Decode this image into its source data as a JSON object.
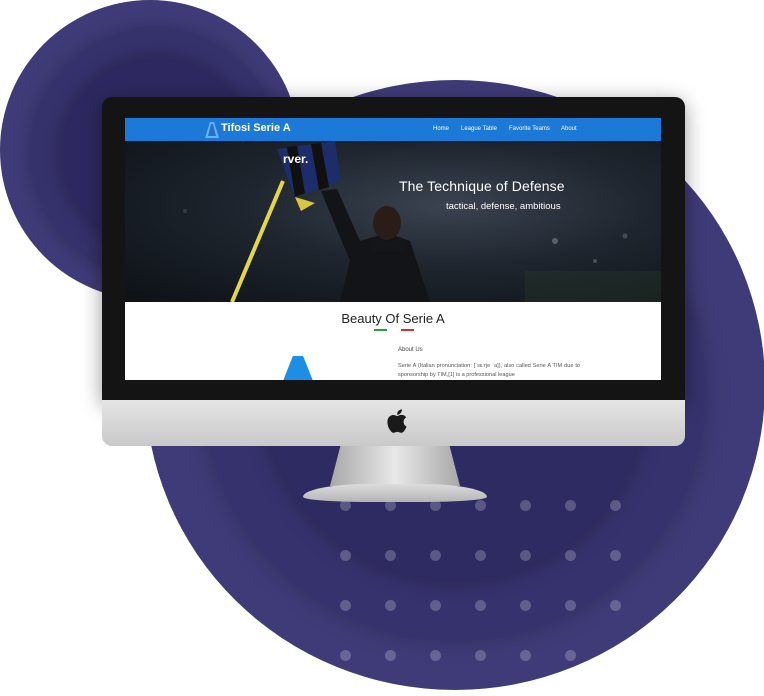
{
  "site": {
    "brand": "Tifosi Serie A",
    "nav": [
      {
        "label": "Home"
      },
      {
        "label": "League Table"
      },
      {
        "label": "Favorite Teams"
      },
      {
        "label": "About"
      }
    ]
  },
  "hero": {
    "title": "The Technique of Defense",
    "subtitle": "tactical, defense, ambitious",
    "shirt_text": "rver."
  },
  "section": {
    "title": "Beauty Of Serie A",
    "flag_colors": [
      "#2e9e44",
      "#ffffff",
      "#d32f2f"
    ]
  },
  "about": {
    "label": "About Us",
    "text": "Serie A (Italian pronunciation: [ˈsɛːrje ˈa]), also called Serie A TIM due to sponsorship by TIM,[1] is a professional league"
  },
  "colors": {
    "nav_blue": "#1c79d8",
    "circle_purple": "#3f3b78"
  },
  "icons": {
    "brand": "serie-a-logo-icon",
    "monitor": "apple-logo-icon"
  }
}
